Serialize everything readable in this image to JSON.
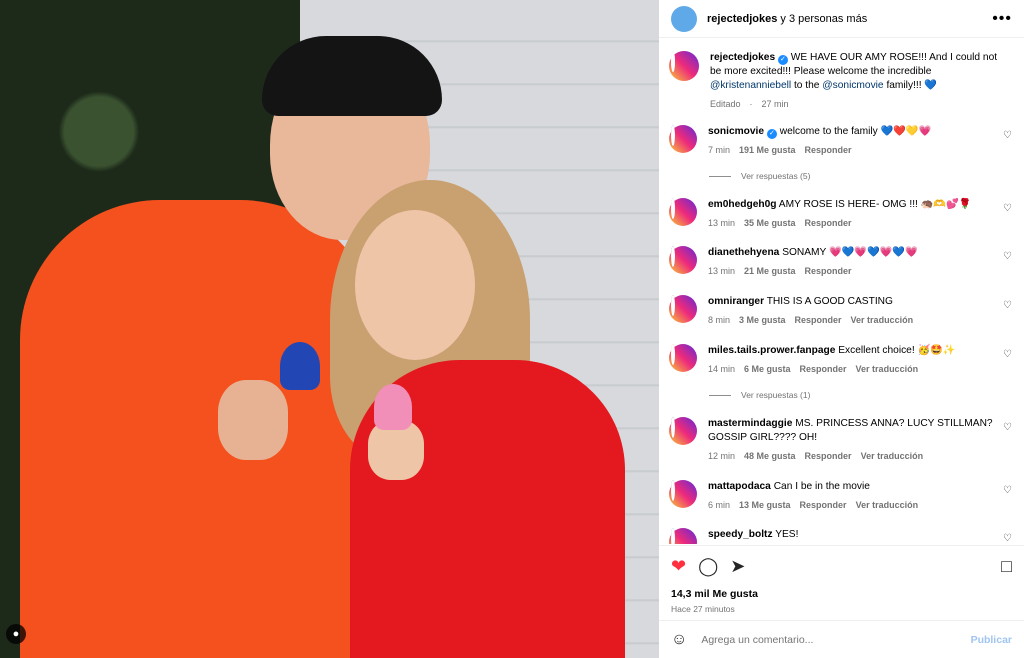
{
  "header": {
    "username": "rejectedjokes",
    "collab_text": " y 3 personas más",
    "more_icon": "more-horizontal-icon"
  },
  "caption": {
    "username": "rejectedjokes",
    "text_1": " WE HAVE OUR AMY ROSE!!! And I could not be more excited!!! Please welcome the incredible ",
    "mention_1": "@kristenanniebell",
    "text_2": " to the ",
    "mention_2": "@sonicmovie",
    "text_3": " family!!! 💙",
    "edited": "Editado",
    "time": "27 min"
  },
  "comments": [
    {
      "username": "sonicmovie",
      "verified": true,
      "text": "welcome to the family 💙❤️💛💗",
      "time": "7 min",
      "likes": "191 Me gusta",
      "reply": "Responder",
      "translate": "",
      "replies": "Ver respuestas (5)",
      "avatar_color": "#1f3aa8"
    },
    {
      "username": "em0hedgeh0g",
      "verified": false,
      "text": "AMY ROSE IS HERE- OMG !!! 🦔🫶💕🌹",
      "time": "13 min",
      "likes": "35 Me gusta",
      "reply": "Responder",
      "translate": "",
      "replies": "",
      "avatar_color": "#e86ba8"
    },
    {
      "username": "dianethehyena",
      "verified": false,
      "text": "SONAMY 💗💙💗💙💗💙💗",
      "time": "13 min",
      "likes": "21 Me gusta",
      "reply": "Responder",
      "translate": "",
      "replies": "",
      "avatar_color": "#2b2b2b"
    },
    {
      "username": "omniranger",
      "verified": false,
      "text": "THIS IS A GOOD CASTING",
      "time": "8 min",
      "likes": "3 Me gusta",
      "reply": "Responder",
      "translate": "Ver traducción",
      "replies": "",
      "avatar_color": "#3f4a3c"
    },
    {
      "username": "miles.tails.prower.fanpage",
      "verified": false,
      "text": "Excellent choice! 🥳🤩✨",
      "time": "14 min",
      "likes": "6 Me gusta",
      "reply": "Responder",
      "translate": "Ver traducción",
      "replies": "Ver respuestas (1)",
      "avatar_color": "#e79b1a"
    },
    {
      "username": "mastermindaggie",
      "verified": false,
      "text": "MS. PRINCESS ANNA? LUCY STILLMAN? GOSSIP GIRL???? OH!",
      "time": "12 min",
      "likes": "48 Me gusta",
      "reply": "Responder",
      "translate": "Ver traducción",
      "replies": "",
      "avatar_color": "#111111"
    },
    {
      "username": "mattapodaca",
      "verified": false,
      "text": "Can I be in the movie",
      "time": "6 min",
      "likes": "13 Me gusta",
      "reply": "Responder",
      "translate": "Ver traducción",
      "replies": "",
      "avatar_color": "#4a4a4a"
    },
    {
      "username": "speedy_boltz",
      "verified": false,
      "text": "YES!",
      "time": "",
      "likes": "",
      "reply": "",
      "translate": "",
      "replies": "",
      "avatar_color": "#2a56c6"
    }
  ],
  "actions": {
    "likes": "14,3 mil Me gusta",
    "ago": "Hace 27 minutos"
  },
  "composer": {
    "placeholder": "Agrega un comentario...",
    "post_label": "Publicar"
  },
  "colors": {
    "accent": "#0095f6",
    "like_red": "#ff3040",
    "verified_blue": "#1a8cff"
  }
}
